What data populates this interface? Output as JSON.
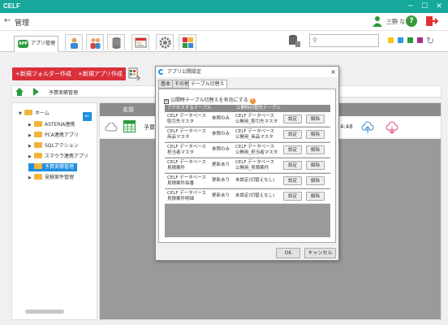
{
  "app": {
    "logo": "CELF"
  },
  "header": {
    "title": "管理",
    "back_icon": "back-arrow-icon",
    "user_name": "三野 なぎさ",
    "help_label": "?"
  },
  "toolbar": {
    "app_tab_logo": "APP",
    "app_tab_label": "アプリ管理",
    "search_placeholder": "",
    "swatches": [
      "#f5c518",
      "#2e9ad8",
      "#2a9a3a",
      "#a83090"
    ]
  },
  "actions": {
    "new_folder": "+新規フォルダー作成",
    "new_app": "+新規アプリ作成"
  },
  "breadcrumb": {
    "current": "予算実績管理"
  },
  "tree": {
    "root": "ホーム",
    "items": [
      {
        "label": "ASTERIA連携",
        "expandable": true
      },
      {
        "label": "PCA連携アプリ",
        "expandable": true
      },
      {
        "label": "SQLアクション",
        "expandable": true
      },
      {
        "label": "スマウラ連携アプリ",
        "expandable": true
      },
      {
        "label": "予算実績管理",
        "expandable": false,
        "selected": true
      },
      {
        "label": "見積案件管理",
        "expandable": true
      }
    ]
  },
  "list": {
    "col_name": "名前",
    "row": {
      "name": "予算",
      "time": "4:48"
    }
  },
  "dialog": {
    "title": "アプリ公開設定",
    "close": "×",
    "tabs": [
      "基本",
      "その他",
      "テーブル切替え"
    ],
    "checkbox_label": "公開時テーブル切替えを有効にする",
    "checkbox_checked": "×",
    "warn_mark": "!",
    "col_source": "アクセスするテーブル",
    "col_target": "公開時切替先テーブル",
    "rows": [
      {
        "src1": "CELF データベース",
        "src2": "取引先マスタ",
        "mode": "参照のみ",
        "dst1": "CELF データベース",
        "dst2": "公開用_取引先マスタ"
      },
      {
        "src1": "CELF データベース",
        "src2": "商品マスタ",
        "mode": "参照のみ",
        "dst1": "CELF データベース",
        "dst2": "公開用_商品マスタ"
      },
      {
        "src1": "CELF データベース",
        "src2": "担当者マスタ",
        "mode": "参照のみ",
        "dst1": "CELF データベース",
        "dst2": "公開用_担当者マスタ"
      },
      {
        "src1": "CELF データベース",
        "src2": "見積案件",
        "mode": "更新あり",
        "dst1": "CELF データベース",
        "dst2": "公開用_見積案件"
      },
      {
        "src1": "CELF データベース",
        "src2": "見積案件採番",
        "mode": "更新あり",
        "dst1": "未設定(切替えなし)",
        "dst2": ""
      },
      {
        "src1": "CELF データベース",
        "src2": "見積案件明細",
        "mode": "更新あり",
        "dst1": "未設定(切替えなし)",
        "dst2": ""
      }
    ],
    "setting_label": "設定",
    "clear_label": "解除",
    "ok_label": "OK",
    "cancel_label": "キャンセル"
  }
}
